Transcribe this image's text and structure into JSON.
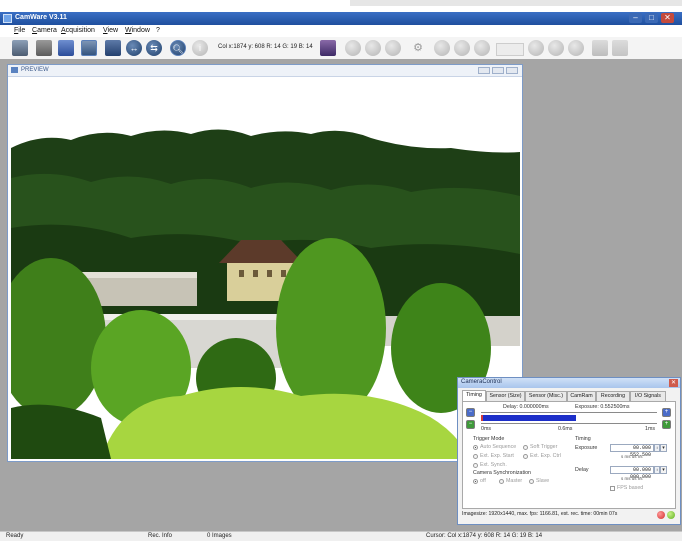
{
  "window": {
    "title": "CamWare V3.11",
    "controls": [
      "–",
      "□",
      "✕"
    ]
  },
  "menu": {
    "items": [
      "File",
      "Camera",
      "Acquisition",
      "View",
      "Window",
      "?"
    ]
  },
  "toolbar": {
    "readout": "Col x:1874 y: 608 R: 14 G: 19 B: 14",
    "icons": [
      "print-icon",
      "camera-icon",
      "image-icon",
      "record-icon",
      "monitor-icon",
      "arrow-left-icon",
      "arrow-right-icon",
      "zoom-icon",
      "info-icon",
      "export-icon",
      "play-icon",
      "stop-icon",
      "record-button-icon",
      "settings-icon",
      "rewind-icon",
      "prev-icon",
      "step-back-icon",
      "step-forward-icon",
      "next-icon",
      "fast-forward-icon",
      "file-icon",
      "grid-icon"
    ]
  },
  "preview": {
    "title": "PREVIEW"
  },
  "statusbar": {
    "status": "Ready",
    "rec_info_label": "Rec. Info",
    "images": "0 Images",
    "cursor": "Cursor: Col x:1874 y: 608 R: 14 G: 19 B: 14"
  },
  "camera_control": {
    "title": "CameraControl",
    "tabs": [
      "Timing",
      "Sensor (Size)",
      "Sensor (Misc.)",
      "CamRam",
      "Recording",
      "I/O Signals"
    ],
    "active_tab": "Timing",
    "delay_label": "Delay: 0.000000ms",
    "exposure_label": "Exposure: 0.552500ms",
    "scale_start": "0ms",
    "scale_mid": "0.6ms",
    "scale_end": "1ms",
    "trigger_mode_label": "Trigger Mode",
    "trigger_options": [
      "Auto Sequence",
      "Soft Trigger",
      "Ext. Exp. Start",
      "Ext. Exp. Ctrl",
      "Ext. Synch."
    ],
    "selected_trigger": "Auto Sequence",
    "sync_label": "Camera Synchronization",
    "sync_options": [
      "off",
      "Master",
      "Slave"
    ],
    "selected_sync": "off",
    "timing_label": "Timing",
    "exposure_field_label": "Exposure",
    "exposure_value": "00.000 552.500",
    "exposure_unit": "s ms us ns",
    "delay_field_label": "Delay",
    "delay_value": "00.000 000.000",
    "delay_unit": "s ms us ns",
    "fps_label": "FPS based",
    "status_line": "Imagesize: 1920x1440, max. fps: 1166.81, est. rec. time: 00min 07s"
  },
  "colors": {
    "title_bar": "#1f4f9e",
    "workspace": "#a5a5a5",
    "accent_blue": "#2a53c8",
    "exposure_bar": "#1d2fc9",
    "delay_bar": "#d23a3a"
  }
}
